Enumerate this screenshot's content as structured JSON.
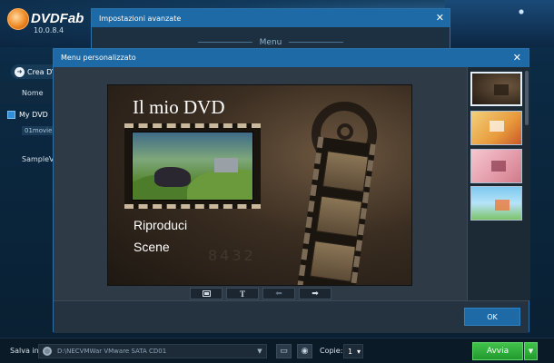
{
  "app": {
    "brand": "DVDFab",
    "version": "10.0.8.4",
    "create_button": "Crea DV",
    "column_name": "Nome",
    "items": [
      {
        "label": "My DVD",
        "chip": "01movie"
      },
      {
        "label": "SampleVi"
      }
    ]
  },
  "bottom_bar": {
    "save_label": "Salva in:",
    "save_path": "D:\\NECVMWar VMware SATA CD01",
    "copies_label": "Copie:",
    "copies_value": "1",
    "start_label": "Avvia"
  },
  "advanced_dialog": {
    "title": "Impostazioni avanzate",
    "tab_label": "Menu"
  },
  "menu_dialog": {
    "title": "Menu personalizzato",
    "ok_label": "OK",
    "canvas": {
      "title": "Il mio DVD",
      "play_label": "Riproduci",
      "scenes_label": "Scene",
      "watermark": "8432"
    },
    "tools": [
      {
        "icon": "image-icon"
      },
      {
        "icon": "text-icon",
        "glyph": "T"
      },
      {
        "icon": "arrow-left-icon",
        "glyph": "⬅"
      },
      {
        "icon": "arrow-right-icon",
        "glyph": "➡"
      }
    ],
    "templates": [
      {
        "name": "template-film",
        "selected": true
      },
      {
        "name": "template-orange"
      },
      {
        "name": "template-pink"
      },
      {
        "name": "template-cartoon"
      }
    ]
  },
  "colors": {
    "title_bar": "#1e6aa6",
    "start_green": "#229a2d"
  }
}
